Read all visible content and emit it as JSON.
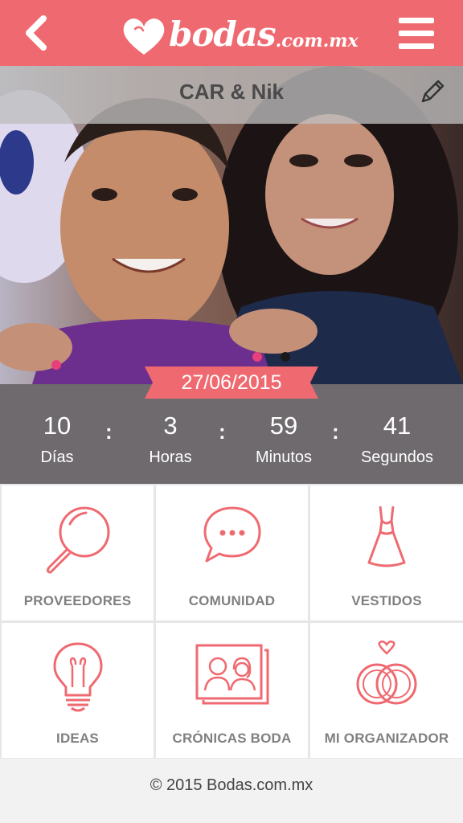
{
  "header": {
    "brand": "bodas",
    "brand_suffix": ".com.mx",
    "back_icon": "chevron-left-icon",
    "menu_icon": "hamburger-menu-icon",
    "color": "#ef6a70"
  },
  "event": {
    "couple_name": "CAR & Nik",
    "edit_icon": "pencil-icon",
    "date": "27/06/2015"
  },
  "countdown": [
    {
      "value": "10",
      "label": "Días"
    },
    {
      "value": "3",
      "label": "Horas"
    },
    {
      "value": "59",
      "label": "Minutos"
    },
    {
      "value": "41",
      "label": "Segundos"
    }
  ],
  "countdown_separator": ":",
  "menu_tiles": [
    {
      "label": "PROVEEDORES",
      "icon": "magnifier-icon"
    },
    {
      "label": "COMUNIDAD",
      "icon": "chat-bubble-icon"
    },
    {
      "label": "VESTIDOS",
      "icon": "dress-icon"
    },
    {
      "label": "IDEAS",
      "icon": "lightbulb-icon"
    },
    {
      "label": "CRÓNICAS BODA",
      "icon": "couple-photos-icon"
    },
    {
      "label": "MI ORGANIZADOR",
      "icon": "wedding-rings-icon"
    }
  ],
  "footer": {
    "copyright": "© 2015 Bodas.com.mx"
  }
}
